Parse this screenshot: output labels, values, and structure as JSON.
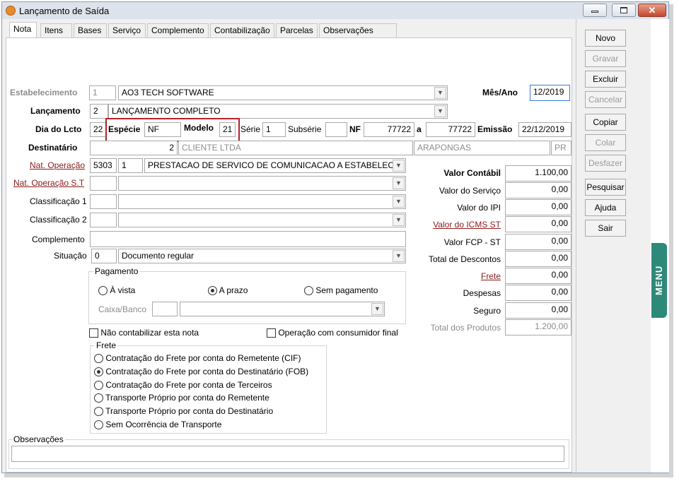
{
  "window": {
    "title": "Lançamento de Saída",
    "controls": [
      "minimize",
      "maximize",
      "close"
    ]
  },
  "tabs": [
    "Nota",
    "Itens",
    "Bases",
    "Serviço",
    "Complemento",
    "Contabilização",
    "Parcelas",
    "Observações EFD"
  ],
  "active_tab": "Nota",
  "sidebar": {
    "novo": "Novo",
    "gravar": "Gravar",
    "excluir": "Excluir",
    "cancelar": "Cancelar",
    "copiar": "Copiar",
    "colar": "Colar",
    "desfazer": "Desfazer",
    "pesquisar": "Pesquisar",
    "ajuda": "Ajuda",
    "sair": "Sair",
    "menu_tab": "MENU"
  },
  "form": {
    "estabelecimento": {
      "label": "Estabelecimento",
      "code": "1",
      "name": "AO3 TECH SOFTWARE"
    },
    "mes_ano": {
      "label": "Mês/Ano",
      "value": "12/2019"
    },
    "lancamento": {
      "label": "Lançamento",
      "code": "2",
      "name": "LANÇAMENTO COMPLETO"
    },
    "dia_lcto": {
      "label": "Dia do Lcto",
      "value": "22"
    },
    "especie": {
      "label": "Espécie",
      "value": "NF"
    },
    "modelo": {
      "label": "Modelo",
      "value": "21"
    },
    "serie": {
      "label": "Série",
      "value": "1"
    },
    "subserie": {
      "label": "Subsérie",
      "value": ""
    },
    "nf": {
      "label": "NF",
      "from": "77722",
      "sep": "a",
      "to": "77722"
    },
    "emissao": {
      "label": "Emissão",
      "value": "22/12/2019"
    },
    "destinatario": {
      "label": "Destinatário",
      "code": "2",
      "name": "CLIENTE LTDA",
      "city": "ARAPONGAS",
      "uf": "PR"
    },
    "nat_operacao": {
      "label": "Nat. Operação",
      "code": "5303",
      "seq": "1",
      "desc": "PRESTACAO DE SERVICO DE COMUNICACAO A ESTABELECIM"
    },
    "nat_operacao_st": {
      "label": "Nat. Operação S.T",
      "code": "",
      "desc": ""
    },
    "classificacao1": {
      "label": "Classificação 1",
      "code": "",
      "desc": ""
    },
    "classificacao2": {
      "label": "Classificação 2",
      "code": "",
      "desc": ""
    },
    "complemento": {
      "label": "Complemento",
      "value": ""
    },
    "situacao": {
      "label": "Situação",
      "code": "0",
      "desc": "Documento regular"
    }
  },
  "pagamento": {
    "label": "Pagamento",
    "options": [
      "À vista",
      "A prazo",
      "Sem pagamento"
    ],
    "selected": "A prazo",
    "caixa_banco_label": "Caixa/Banco",
    "caixa_banco_code": "",
    "caixa_banco_desc": ""
  },
  "checks": {
    "nao_contabilizar": {
      "label": "Não contabilizar esta nota",
      "checked": false
    },
    "consumidor_final": {
      "label": "Operação com consumidor final",
      "checked": false
    }
  },
  "frete": {
    "label": "Frete",
    "options": [
      "Contratação do Frete por conta do Remetente (CIF)",
      "Contratação do Frete por conta do Destinatário (FOB)",
      "Contratação do Frete por conta de Terceiros",
      "Transporte Próprio por conta do Remetente",
      "Transporte Próprio por conta do Destinatário",
      "Sem Ocorrência de Transporte"
    ],
    "selected_index": 1
  },
  "observacoes": {
    "label": "Observações",
    "value": ""
  },
  "valores": {
    "valor_contabil": {
      "label": "Valor Contábil",
      "value": "1.100,00"
    },
    "valor_servico": {
      "label": "Valor do Serviço",
      "value": "0,00"
    },
    "valor_ipi": {
      "label": "Valor do IPI",
      "value": "0,00"
    },
    "valor_icms_st": {
      "label": "Valor do ICMS ST",
      "value": "0,00"
    },
    "valor_fcp_st": {
      "label": "Valor FCP - ST",
      "value": "0,00"
    },
    "total_descontos": {
      "label": "Total de Descontos",
      "value": "0,00"
    },
    "frete": {
      "label": "Frete",
      "value": "0,00"
    },
    "despesas": {
      "label": "Despesas",
      "value": "0,00"
    },
    "seguro": {
      "label": "Seguro",
      "value": "0,00"
    },
    "total_produtos": {
      "label": "Total dos Produtos",
      "value": "1.200,00"
    }
  }
}
